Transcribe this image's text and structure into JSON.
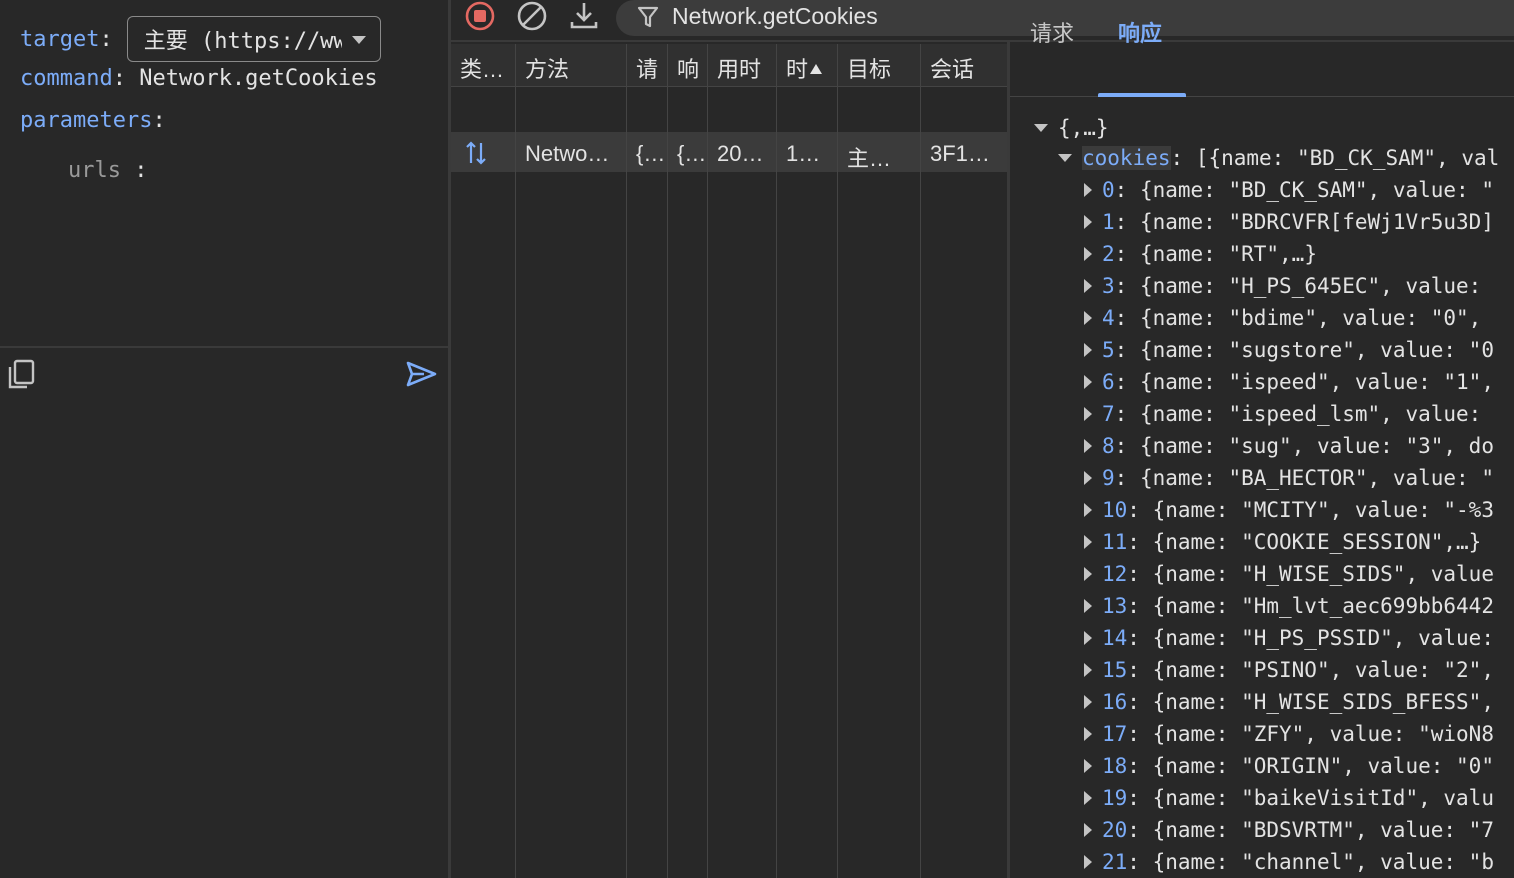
{
  "left_panel": {
    "target_label": "target",
    "target_value": "主要 (https://ww",
    "command_label": "command",
    "command_value": "Network.getCookies",
    "parameters_label": "parameters",
    "urls_label": "urls",
    "colon": ":"
  },
  "toolbar": {
    "filter_text": "Network.getCookies"
  },
  "grid": {
    "headers": [
      "类…",
      "方法",
      "请",
      "响",
      "用时",
      "时",
      "目标",
      "会话"
    ],
    "row": [
      "Netwo…",
      "{…",
      "{…",
      "20…",
      "1…",
      "主…",
      "3F1…"
    ]
  },
  "tabs": {
    "request": "请求",
    "response": "响应"
  },
  "tree": {
    "root": "{,…}",
    "cookies_key": "cookies",
    "cookies_summary": "[{name: \"BD_CK_SAM\", val",
    "items": [
      {
        "index": "0",
        "text": "{name: \"BD_CK_SAM\", value: \""
      },
      {
        "index": "1",
        "text": "{name: \"BDRCVFR[feWj1Vr5u3D]"
      },
      {
        "index": "2",
        "text": "{name: \"RT\",…}"
      },
      {
        "index": "3",
        "text": "{name: \"H_PS_645EC\", value: "
      },
      {
        "index": "4",
        "text": "{name: \"bdime\", value: \"0\", "
      },
      {
        "index": "5",
        "text": "{name: \"sugstore\", value: \"0"
      },
      {
        "index": "6",
        "text": "{name: \"ispeed\", value: \"1\","
      },
      {
        "index": "7",
        "text": "{name: \"ispeed_lsm\", value: "
      },
      {
        "index": "8",
        "text": "{name: \"sug\", value: \"3\", do"
      },
      {
        "index": "9",
        "text": "{name: \"BA_HECTOR\", value: \""
      },
      {
        "index": "10",
        "text": "{name: \"MCITY\", value: \"-%3"
      },
      {
        "index": "11",
        "text": "{name: \"COOKIE_SESSION\",…}"
      },
      {
        "index": "12",
        "text": "{name: \"H_WISE_SIDS\", value"
      },
      {
        "index": "13",
        "text": "{name: \"Hm_lvt_aec699bb6442"
      },
      {
        "index": "14",
        "text": "{name: \"H_PS_PSSID\", value:"
      },
      {
        "index": "15",
        "text": "{name: \"PSINO\", value: \"2\","
      },
      {
        "index": "16",
        "text": "{name: \"H_WISE_SIDS_BFESS\","
      },
      {
        "index": "17",
        "text": "{name: \"ZFY\", value: \"wioN8"
      },
      {
        "index": "18",
        "text": "{name: \"ORIGIN\", value: \"0\""
      },
      {
        "index": "19",
        "text": "{name: \"baikeVisitId\", valu"
      },
      {
        "index": "20",
        "text": "{name: \"BDSVRTM\", value: \"7"
      },
      {
        "index": "21",
        "text": "{name: \"channel\", value: \"b"
      }
    ]
  },
  "colors": {
    "key_blue": "#7cacf8",
    "stop_red": "#e46962",
    "background": "#282828"
  },
  "icons": [
    "copy-icon",
    "send-icon",
    "stop-recording-icon",
    "clear-icon",
    "download-icon",
    "filter-icon",
    "bidirectional-arrows-icon"
  ]
}
